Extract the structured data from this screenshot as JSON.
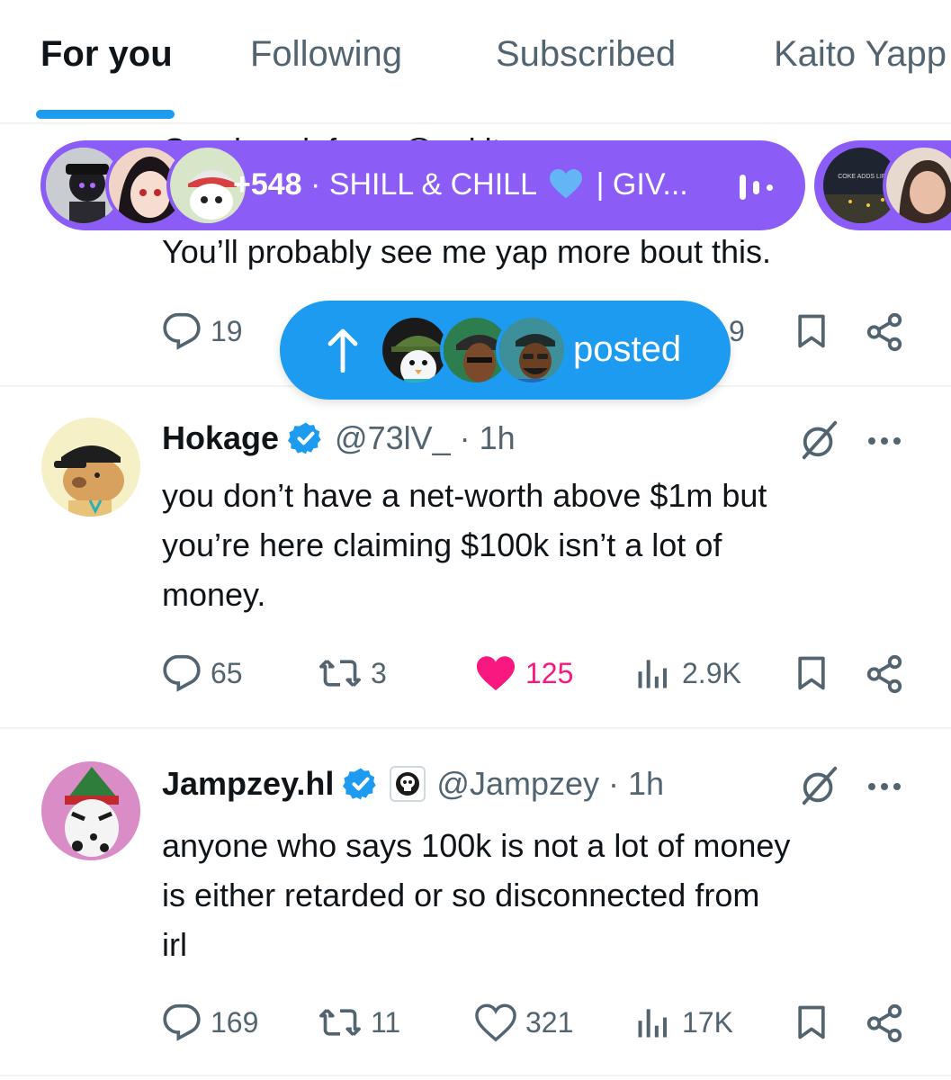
{
  "tabs": [
    {
      "label": "For you",
      "active": true
    },
    {
      "label": "Following",
      "active": false
    },
    {
      "label": "Subscribed",
      "active": false
    },
    {
      "label": "Kaito Yapp",
      "active": false
    }
  ],
  "spaces": {
    "count": "+548",
    "separator": "·",
    "title_prefix": "SHILL & CHILL",
    "title_suffix": "| GIV...",
    "color": "#8b5cf6",
    "mini_avatar_text": "COKE ADDS LIFE!"
  },
  "tweet0": {
    "top_line": "Good work from @zukit",
    "text": "You’ll probably see me yap more bout this.",
    "reply_count": "19",
    "views_tail": "9"
  },
  "posted_pill": {
    "label": "posted",
    "color": "#1d9bf0"
  },
  "tweets": [
    {
      "name": "Hokage",
      "handle": "@73lV_",
      "time": "· 1h",
      "text_lines": [
        "you don’t have a net-worth above $1m but",
        "you’re here claiming $100k isn’t a lot of",
        "money."
      ],
      "replies": "65",
      "retweets": "3",
      "likes": "125",
      "views": "2.9K",
      "liked": true
    },
    {
      "name": "Jampzey.hl",
      "handle": "@Jampzey",
      "time": "· 1h",
      "text_lines": [
        "anyone who says 100k is not a lot of money",
        "is either retarded or so disconnected from",
        "irl"
      ],
      "replies": "169",
      "retweets": "11",
      "likes": "321",
      "views": "17K",
      "liked": false
    }
  ],
  "colors": {
    "accent": "#1d9bf0",
    "like": "#f91880",
    "muted": "#536471",
    "text": "#0f1419"
  }
}
